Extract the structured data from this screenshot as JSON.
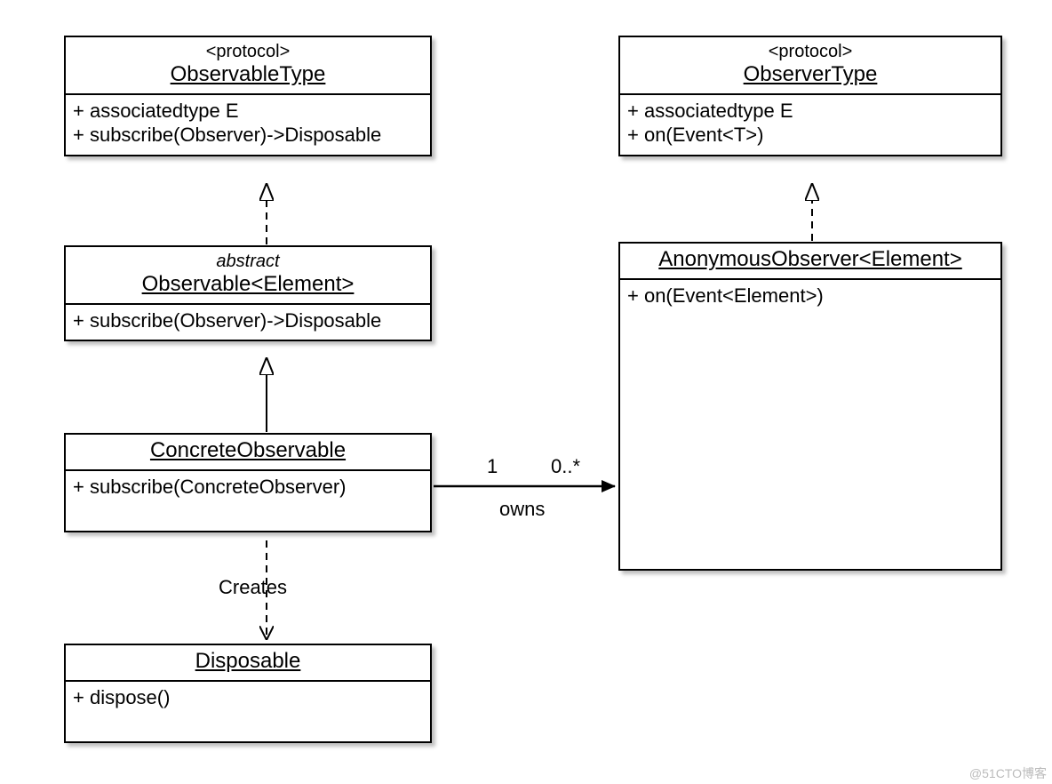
{
  "watermark": "@51CTO博客",
  "boxes": {
    "observableType": {
      "stereotype": "<protocol>",
      "name": "ObservableType",
      "members": [
        "+ associatedtype E",
        "+ subscribe(Observer)->Disposable"
      ]
    },
    "observable": {
      "abstract": "abstract",
      "name": "Observable<Element>",
      "members": [
        "+ subscribe(Observer)->Disposable"
      ]
    },
    "concreteObservable": {
      "name": "ConcreteObservable",
      "members": [
        "+ subscribe(ConcreteObserver)"
      ]
    },
    "disposable": {
      "name": "Disposable",
      "members": [
        "+ dispose()"
      ]
    },
    "observerType": {
      "stereotype": "<protocol>",
      "name": "ObserverType",
      "members": [
        "+ associatedtype E",
        "+ on(Event<T>)"
      ]
    },
    "anonymousObserver": {
      "name": "AnonymousObserver<Element>",
      "members": [
        "+ on(Event<Element>)"
      ]
    }
  },
  "relations": {
    "owns": {
      "label": "owns",
      "mult_left": "1",
      "mult_right": "0..*"
    },
    "creates": {
      "label": "Creates"
    }
  }
}
